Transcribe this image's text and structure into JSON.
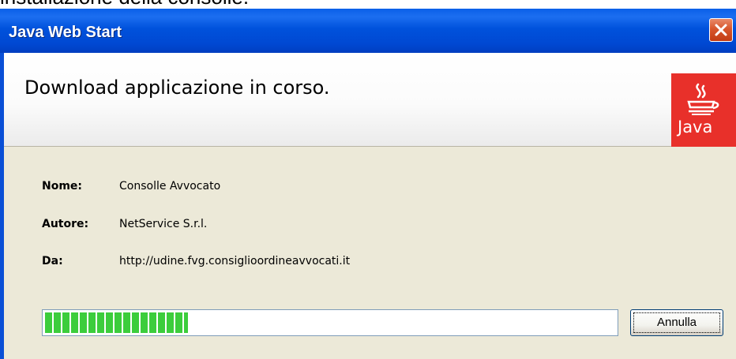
{
  "page_caption": "installazione della consolle.",
  "window": {
    "title": "Java Web Start",
    "close_icon": "close-icon"
  },
  "header": {
    "title": "Download applicazione in corso.",
    "logo_text": "Java",
    "logo_icon": "java-coffee-cup-icon",
    "logo_color": "#e8302a"
  },
  "info": {
    "name_label": "Nome:",
    "name_value": "Consolle Avvocato",
    "author_label": "Autore:",
    "author_value": "NetService S.r.l.",
    "from_label": "Da:",
    "from_value": "http://udine.fvg.consiglioordineavvocati.it"
  },
  "progress": {
    "fraction": 0.25,
    "color": "#3ccd3c"
  },
  "buttons": {
    "cancel_label": "Annulla"
  }
}
